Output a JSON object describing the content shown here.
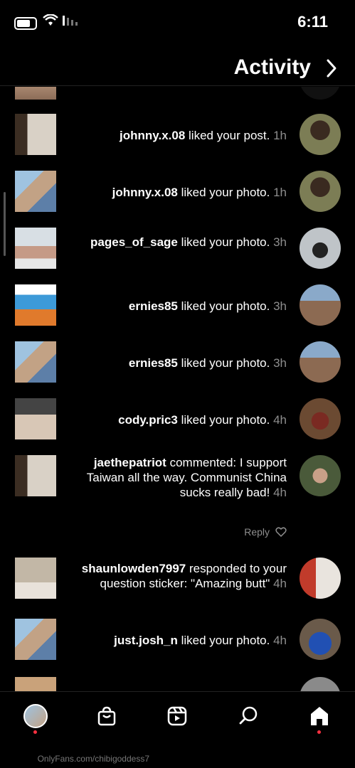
{
  "status_bar": {
    "time": "6:11"
  },
  "header": {
    "title": "Activity",
    "back_icon": "chevron-right-icon"
  },
  "notifications": [
    {
      "username": "johnny.x.08",
      "action": " liked your post.",
      "time": " 1h"
    },
    {
      "username": "johnny.x.08",
      "action": " liked your photo.",
      "time": " 1h"
    },
    {
      "username": "pages_of_sage",
      "action": " liked your photo.",
      "time": " 3h"
    },
    {
      "username": "ernies85",
      "action": " liked your photo.",
      "time": " 3h"
    },
    {
      "username": "ernies85",
      "action": " liked your photo.",
      "time": " 3h"
    },
    {
      "username": "cody.pric3",
      "action": " liked your photo.",
      "time": " 4h"
    },
    {
      "username": "jaethepatriot",
      "action": " commented: I support Taiwan all the way. Communist China sucks really bad!",
      "time": " 4h",
      "reply_label": "Reply"
    },
    {
      "username": "shaunlowden7997",
      "action": " responded to your question sticker: \"Amazing butt\"",
      "time": " 4h"
    },
    {
      "username": "just.josh_n",
      "action": " liked your photo.",
      "time": " 4h"
    }
  ],
  "tab_bar": {
    "tabs": [
      "home-icon",
      "search-icon",
      "reels-icon",
      "shop-icon",
      "profile-avatar"
    ]
  },
  "watermark": "OnlyFans.com/chibigoddess7",
  "colors": {
    "background": "#000000",
    "secondary_text": "#8e8e8e",
    "badge": "#ff3040"
  }
}
